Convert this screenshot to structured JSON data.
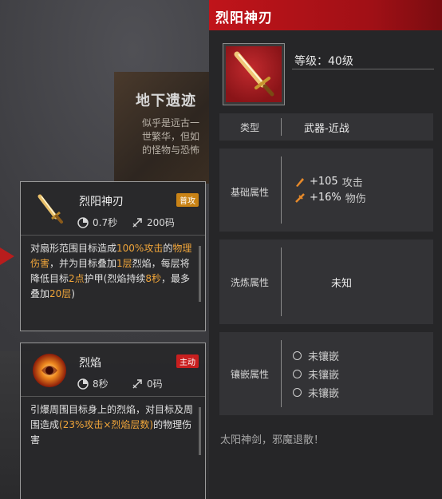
{
  "background": {
    "dungeon_title": "地下遗迹",
    "dungeon_desc": "似乎是远古一\n世繁华，但如\n的怪物与恐怖"
  },
  "skills": [
    {
      "name": "烈阳神刃",
      "tag": "普攻",
      "tag_color": "#c98316",
      "cooldown": "0.7秒",
      "range": "200码",
      "desc": [
        {
          "t": "对扇形范围目标造成",
          "hl": false
        },
        {
          "t": "100%攻击",
          "hl": true
        },
        {
          "t": "的",
          "hl": false
        },
        {
          "t": "物理伤害",
          "hl": true
        },
        {
          "t": "，并为目标叠加",
          "hl": false
        },
        {
          "t": "1层",
          "hl": true
        },
        {
          "t": "烈焰，每层将降低目标",
          "hl": false
        },
        {
          "t": "2点",
          "hl": true
        },
        {
          "t": "护甲(烈焰持续",
          "hl": false
        },
        {
          "t": "8秒",
          "hl": true
        },
        {
          "t": "，最多叠加",
          "hl": false
        },
        {
          "t": "20层",
          "hl": true
        },
        {
          "t": ")",
          "hl": false
        }
      ]
    },
    {
      "name": "烈焰",
      "tag": "主动",
      "tag_color": "#c91f1f",
      "cooldown": "8秒",
      "range": "0码",
      "desc": [
        {
          "t": "引爆周围目标身上的烈焰，对目标及周围造成",
          "hl": false
        },
        {
          "t": "(23%攻击×烈焰层数)",
          "hl": true
        },
        {
          "t": "的物理伤害",
          "hl": false
        }
      ]
    }
  ],
  "item": {
    "name": "烈阳神刃",
    "level_label": "等级：40级",
    "rows": {
      "type_label": "类型",
      "type_value": "武器-近战",
      "base_label": "基础属性",
      "base_attrs": [
        {
          "value": "+105",
          "suffix": "攻击",
          "icon": "attack-icon"
        },
        {
          "value": "+16%",
          "suffix": "物伤",
          "icon": "physical-damage-icon"
        }
      ],
      "refine_label": "洗炼属性",
      "refine_value": "未知",
      "socket_label": "镶嵌属性",
      "sockets": [
        "未镶嵌",
        "未镶嵌",
        "未镶嵌"
      ]
    },
    "flavor_text": "太阳神剑，邪魔退散！"
  },
  "colors": {
    "header_red": "#c0141a",
    "highlight_orange": "#f0a53a",
    "attr_icon_orange": "#e88a2a"
  }
}
